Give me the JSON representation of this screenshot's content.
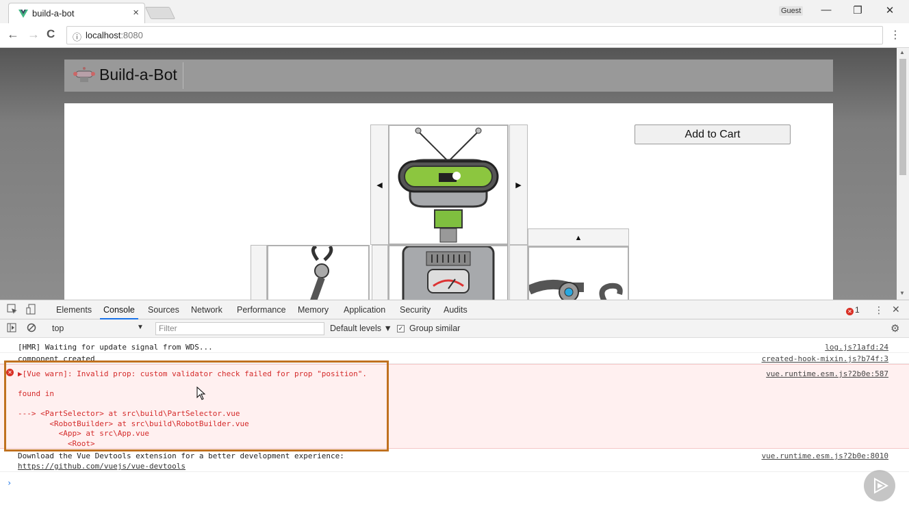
{
  "browser": {
    "tab_title": "build-a-bot",
    "tab_close": "×",
    "profile": "Guest",
    "window_controls": [
      "—",
      "❐",
      "✕"
    ],
    "nav": {
      "back": "←",
      "forward": "→",
      "reload": "C"
    },
    "url_info_icon": "ⓘ",
    "url_host": "localhost",
    "url_port": ":8080",
    "menu": "⋮"
  },
  "app": {
    "title": "Build-a-Bot",
    "add_to_cart": "Add to Cart",
    "selector_prev": "◀",
    "selector_next": "▶",
    "selector_up": "▲"
  },
  "devtools": {
    "tabs": [
      "Elements",
      "Console",
      "Sources",
      "Network",
      "Performance",
      "Memory",
      "Application",
      "Security",
      "Audits"
    ],
    "active_tab": "Console",
    "error_count": "1",
    "more": "⋮",
    "close": "✕",
    "context": "top",
    "filter_placeholder": "Filter",
    "levels": "Default levels ▼",
    "group_similar": "Group similar",
    "group_checked": "✓"
  },
  "console": {
    "messages": [
      {
        "text": "[HMR] Waiting for update signal from WDS...",
        "source": "log.js?1afd:24"
      },
      {
        "text": "component created",
        "source": "created-hook-mixin.js?b74f:3"
      },
      {
        "type": "error",
        "text": "▶[Vue warn]: Invalid prop: custom validator check failed for prop \"position\".\n\nfound in\n\n---> <PartSelector> at src\\build\\PartSelector.vue\n       <RobotBuilder> at src\\build\\RobotBuilder.vue\n         <App> at src\\App.vue\n           <Root>",
        "source": "vue.runtime.esm.js?2b0e:587"
      },
      {
        "text": "Download the Vue Devtools extension for a better development experience:",
        "link": "https://github.com/vuejs/vue-devtools",
        "source": "vue.runtime.esm.js?2b0e:8010"
      }
    ],
    "prompt": "›"
  },
  "colors": {
    "highlight_box": "#c0711f",
    "error_text": "#d42a2a",
    "error_bg": "#fff0f0",
    "robot_green": "#8cc63f"
  }
}
